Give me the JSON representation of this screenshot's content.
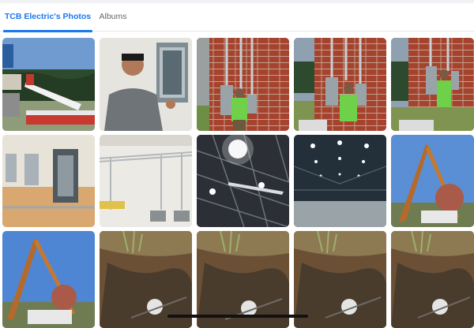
{
  "tabs": [
    {
      "label": "TCB Electric's Photos",
      "active": true
    },
    {
      "label": "Albums",
      "active": false
    }
  ],
  "colors": {
    "accent": "#1877f2",
    "inactive_text": "#65676b",
    "divider": "#e4e6eb"
  },
  "photos": [
    {
      "subject": "bucket truck beside sign"
    },
    {
      "subject": "man with electrical panel"
    },
    {
      "subject": "worker by meters on brick wall"
    },
    {
      "subject": "worker by meters on brick wall"
    },
    {
      "subject": "worker by meters on brick wall"
    },
    {
      "subject": "panels on interior wall"
    },
    {
      "subject": "conduit on wall"
    },
    {
      "subject": "warehouse ceiling lights"
    },
    {
      "subject": "warehouse interior lights"
    },
    {
      "subject": "crane truck and tree"
    },
    {
      "subject": "crane truck and sky"
    },
    {
      "subject": "trench in dirt"
    },
    {
      "subject": "trench in dirt"
    },
    {
      "subject": "trench in dirt"
    },
    {
      "subject": "trench in dirt"
    }
  ]
}
